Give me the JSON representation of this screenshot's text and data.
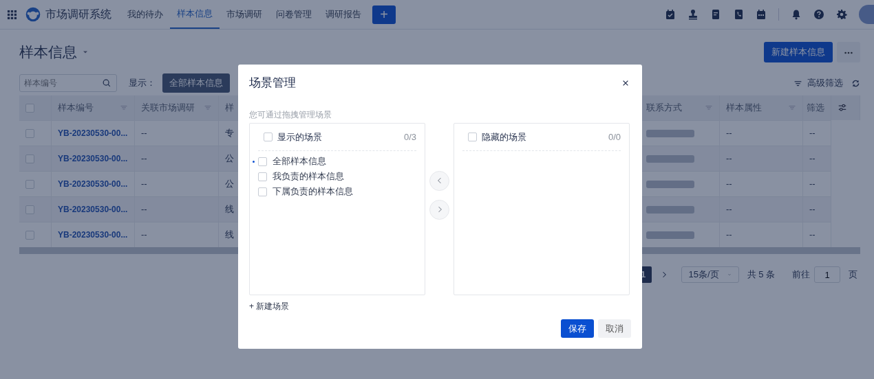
{
  "nav": {
    "app_title": "市场调研系统",
    "items": [
      {
        "label": "我的待办",
        "selected": false
      },
      {
        "label": "样本信息",
        "selected": true
      },
      {
        "label": "市场调研",
        "selected": false
      },
      {
        "label": "问卷管理",
        "selected": false
      },
      {
        "label": "调研报告",
        "selected": false
      }
    ],
    "add_button": "+"
  },
  "page": {
    "title": "样本信息",
    "new_button": "新建样本信息"
  },
  "toolbar": {
    "search": {
      "placeholder": "样本编号"
    },
    "display_label": "显示：",
    "scenes": [
      {
        "label": "全部样本信息",
        "selected": true
      }
    ],
    "advanced_filter": "高级筛选"
  },
  "table": {
    "columns": [
      "样本编号",
      "关联市场调研",
      "样",
      "联系方式",
      "样本属性",
      "筛选"
    ],
    "header_checked": false,
    "rows": [
      {
        "checked": false,
        "sample_no": "YB-20230530-00...",
        "linked_research": "--",
        "column_3": "专",
        "sample_attribute": "--",
        "column_6": "--"
      },
      {
        "checked": false,
        "sample_no": "YB-20230530-00...",
        "linked_research": "--",
        "column_3": "公",
        "sample_attribute": "--",
        "column_6": "--"
      },
      {
        "checked": false,
        "sample_no": "YB-20230530-00...",
        "linked_research": "--",
        "column_3": "公",
        "sample_attribute": "--",
        "column_6": "--"
      },
      {
        "checked": false,
        "sample_no": "YB-20230530-00...",
        "linked_research": "--",
        "column_3": "线",
        "sample_attribute": "--",
        "column_6": "--"
      },
      {
        "checked": false,
        "sample_no": "YB-20230530-00...",
        "linked_research": "--",
        "column_3": "线",
        "sample_attribute": "--",
        "column_6": "--"
      }
    ]
  },
  "pagination": {
    "pages": [
      {
        "label": "1",
        "selected": true
      }
    ],
    "page_size": "15条/页",
    "total": "共 5 条",
    "goto_label": "前往",
    "goto_value": "1",
    "page_unit": "页"
  },
  "modal": {
    "title": "场景管理",
    "hint": "您可通过拖拽管理场景",
    "shown": {
      "title": "显示的场景",
      "count": "0/3",
      "checked": false,
      "items": [
        {
          "label": "全部样本信息",
          "checked": false,
          "current": true
        },
        {
          "label": "我负责的样本信息",
          "checked": false,
          "current": false
        },
        {
          "label": "下属负责的样本信息",
          "checked": false,
          "current": false
        }
      ]
    },
    "hidden": {
      "title": "隐藏的场景",
      "count": "0/0",
      "checked": false
    },
    "transfer_disabled": true,
    "new_scene": "+ 新建场景",
    "save": "保存",
    "cancel": "取消"
  }
}
